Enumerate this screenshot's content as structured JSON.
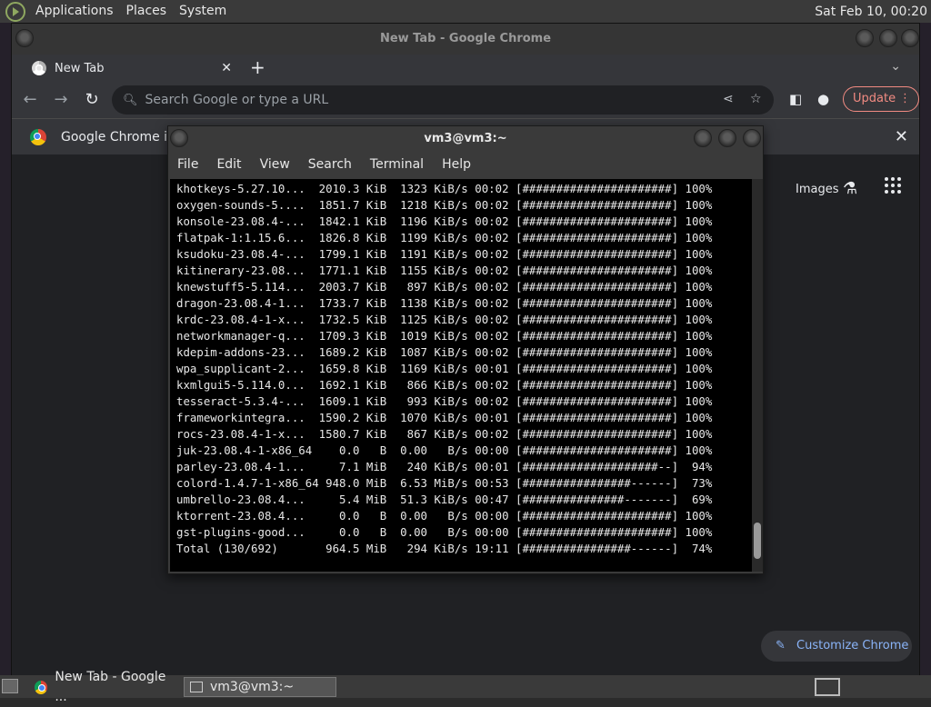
{
  "top_panel": {
    "menus": [
      "Applications",
      "Places",
      "System"
    ],
    "clock": "Sat Feb 10, 00:20"
  },
  "chrome": {
    "window_title": "New Tab - Google Chrome",
    "tab_title": "New Tab",
    "omnibox_placeholder": "Search Google or type a URL",
    "update_label": "Update",
    "infobar_text": "Google Chrome isn",
    "images_link": "Images",
    "customize_label": "Customize Chrome"
  },
  "terminal": {
    "window_title": "vm3@vm3:~",
    "menus": [
      "File",
      "Edit",
      "View",
      "Search",
      "Terminal",
      "Help"
    ],
    "lines": [
      "khotkeys-5.27.10...  2010.3 KiB  1323 KiB/s 00:02 [######################] 100%",
      "oxygen-sounds-5....  1851.7 KiB  1218 KiB/s 00:02 [######################] 100%",
      "konsole-23.08.4-...  1842.1 KiB  1196 KiB/s 00:02 [######################] 100%",
      "flatpak-1:1.15.6...  1826.8 KiB  1199 KiB/s 00:02 [######################] 100%",
      "ksudoku-23.08.4-...  1799.1 KiB  1191 KiB/s 00:02 [######################] 100%",
      "kitinerary-23.08...  1771.1 KiB  1155 KiB/s 00:02 [######################] 100%",
      "knewstuff5-5.114...  2003.7 KiB   897 KiB/s 00:02 [######################] 100%",
      "dragon-23.08.4-1...  1733.7 KiB  1138 KiB/s 00:02 [######################] 100%",
      "krdc-23.08.4-1-x...  1732.5 KiB  1125 KiB/s 00:02 [######################] 100%",
      "networkmanager-q...  1709.3 KiB  1019 KiB/s 00:02 [######################] 100%",
      "kdepim-addons-23...  1689.2 KiB  1087 KiB/s 00:02 [######################] 100%",
      "wpa_supplicant-2...  1659.8 KiB  1169 KiB/s 00:01 [######################] 100%",
      "kxmlgui5-5.114.0...  1692.1 KiB   866 KiB/s 00:02 [######################] 100%",
      "tesseract-5.3.4-...  1609.1 KiB   993 KiB/s 00:02 [######################] 100%",
      "frameworkintegra...  1590.2 KiB  1070 KiB/s 00:01 [######################] 100%",
      "rocs-23.08.4-1-x...  1580.7 KiB   867 KiB/s 00:02 [######################] 100%",
      "juk-23.08.4-1-x86_64    0.0   B  0.00   B/s 00:00 [######################] 100%",
      "parley-23.08.4-1...     7.1 MiB   240 KiB/s 00:01 [####################--]  94%",
      "colord-1.4.7-1-x86_64 948.0 MiB  6.53 MiB/s 00:53 [################------]  73%",
      "umbrello-23.08.4...     5.4 MiB  51.3 KiB/s 00:47 [###############-------]  69%",
      "ktorrent-23.08.4...     0.0   B  0.00   B/s 00:00 [######################] 100%",
      "gst-plugins-good...     0.0   B  0.00   B/s 00:00 [######################] 100%",
      "Total (130/692)       964.5 MiB   294 KiB/s 19:11 [################------]  74%"
    ]
  },
  "taskbar": {
    "tasks": [
      "New Tab - Google ...",
      "vm3@vm3:~"
    ]
  }
}
